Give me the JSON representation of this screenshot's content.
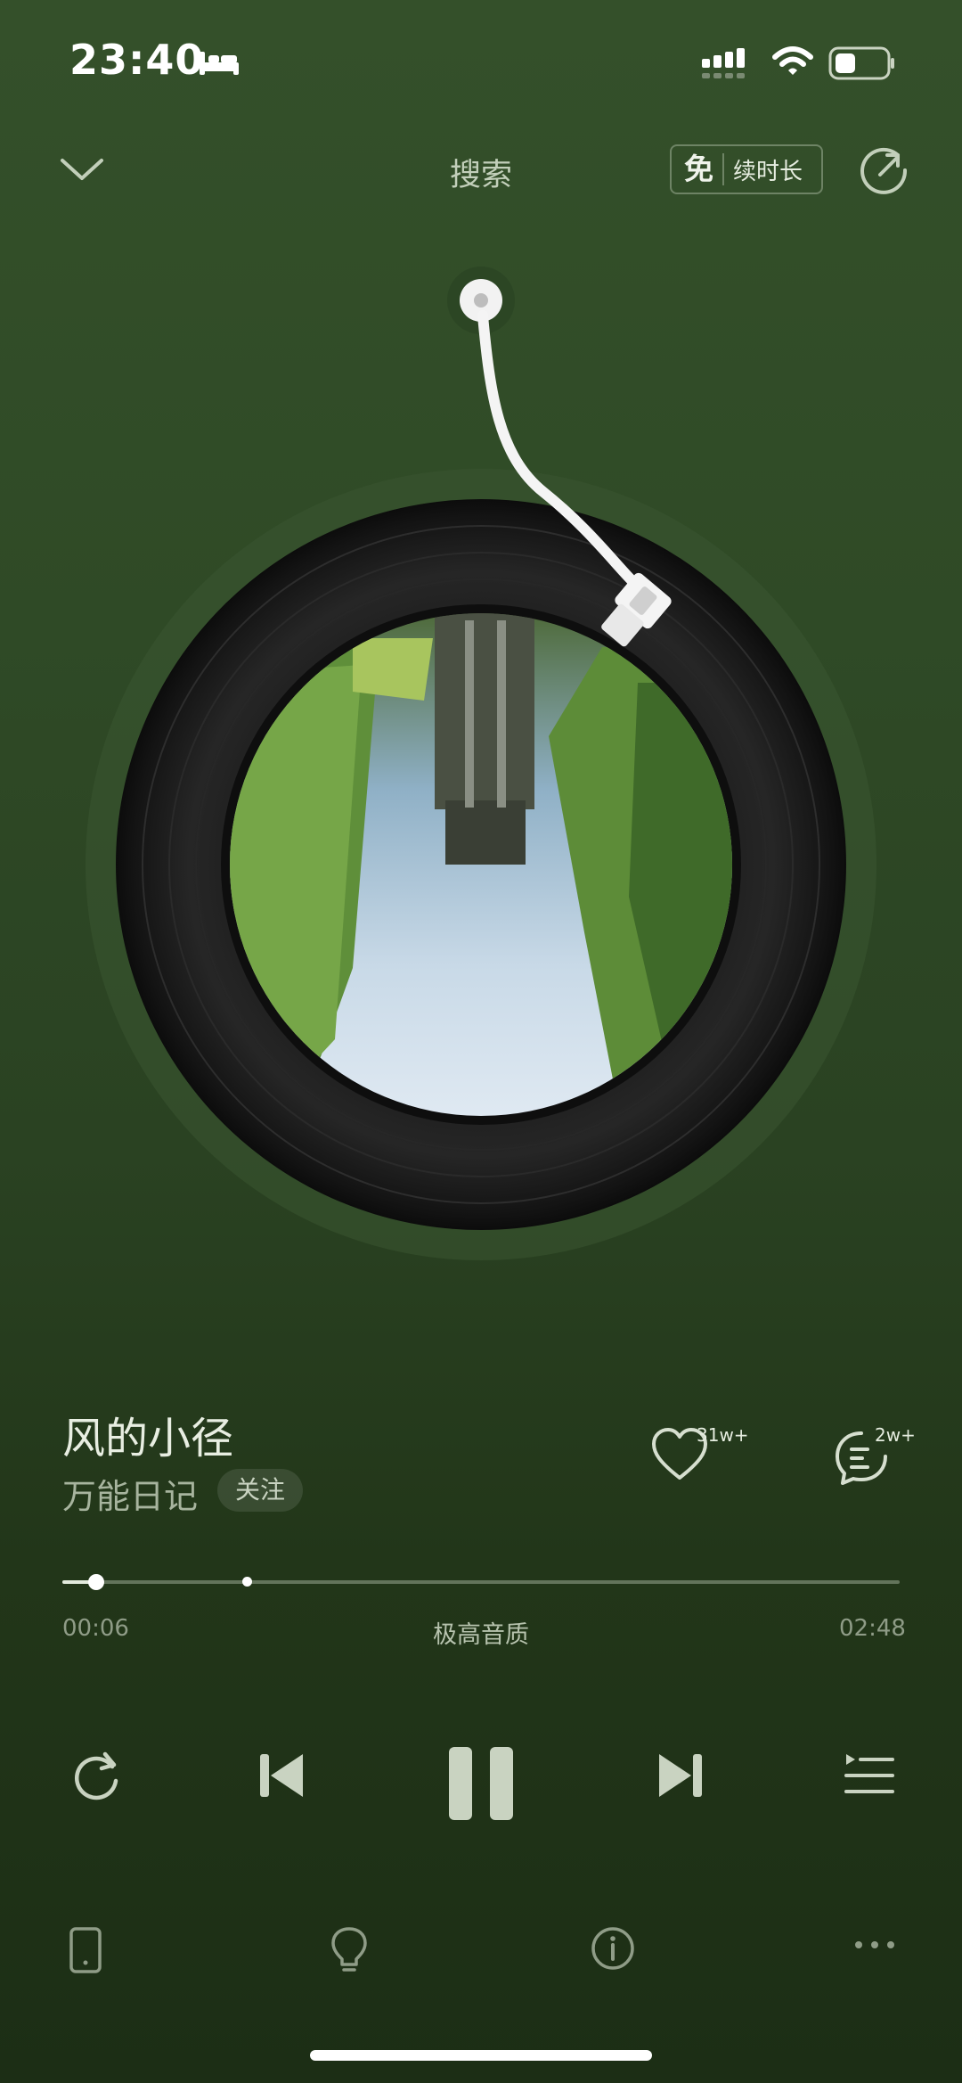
{
  "status": {
    "time": "23:40"
  },
  "header": {
    "search_label": "搜索",
    "vip_free": "免",
    "vip_text": "续时长"
  },
  "song": {
    "title": "风的小径",
    "artist": "万能日记",
    "follow_label": "关注"
  },
  "stats": {
    "likes": "31w+",
    "comments": "2w+"
  },
  "progress": {
    "current": "00:06",
    "total": "02:48",
    "quality": "极高音质",
    "played_fraction": 0.04,
    "buffered_fraction": 0.22
  },
  "colors": {
    "background_top": "#34502a",
    "background_bottom": "#1c2e15",
    "text_primary": "#e8eee2",
    "text_secondary": "#a7b49e"
  },
  "icons": {
    "top_left": "chevron-down-icon",
    "top_right": "share-icon",
    "controls": [
      "repeat-icon",
      "previous-icon",
      "pause-icon",
      "next-icon",
      "playlist-icon"
    ],
    "bottom": [
      "device-icon",
      "lightbulb-icon",
      "info-icon",
      "more-icon"
    ]
  }
}
